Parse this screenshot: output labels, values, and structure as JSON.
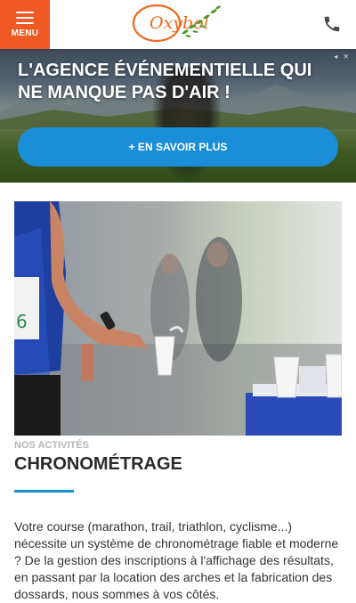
{
  "header": {
    "menu_label": "MENU",
    "logo_text": "Oxybol",
    "phone_icon": "phone-icon"
  },
  "hero": {
    "title": "L'AGENCE ÉVÉNEMENTIELLE QUI NE MANQUE PAS D'AIR !",
    "cta_label": "+ EN SAVOIR PLUS",
    "indicator_left": "◂",
    "indicator_right": "✕"
  },
  "activity": {
    "label": "NOS ACTIVITÉS",
    "title": "CHRONOMÉTRAGE",
    "body": "Votre course (marathon, trail, triathlon, cyclisme...) nécessite un système de chronométrage fiable et moderne ? De la gestion des inscriptions à l'affichage des résultats, en passant par la location des arches et la fabrication des dossards, nous sommes à vos côtés."
  },
  "colors": {
    "menu_bg": "#ef5a24",
    "accent_blue": "#1b8ed8",
    "logo_orange": "#ef6a1f",
    "logo_green": "#4a9a2a"
  }
}
